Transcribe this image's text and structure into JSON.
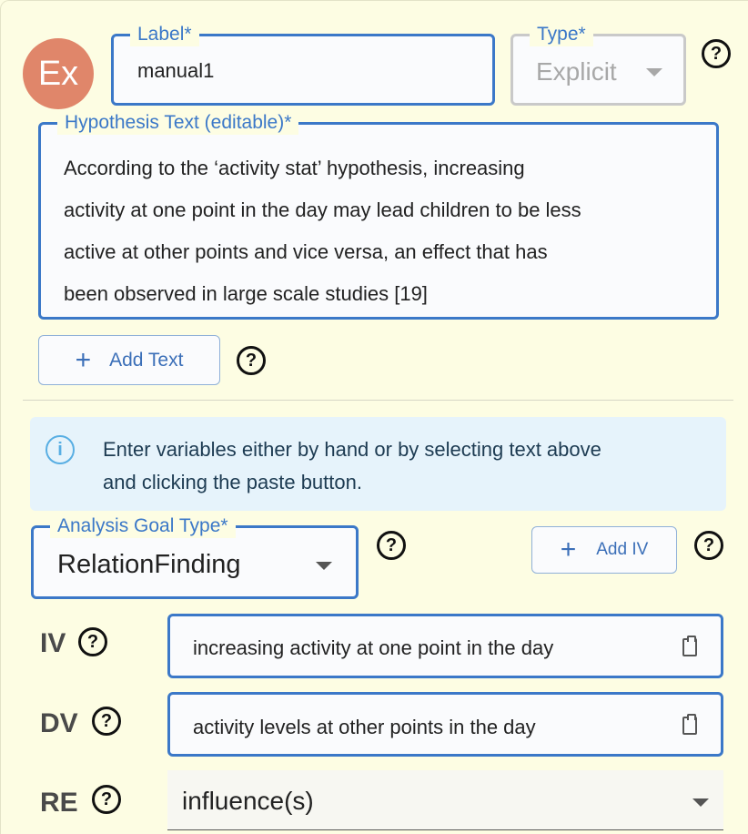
{
  "avatar": {
    "text": "Ex"
  },
  "label_field": {
    "label": "Label",
    "required": "*",
    "value": "manual1"
  },
  "type_field": {
    "label": "Type",
    "required": "*",
    "value": "Explicit"
  },
  "hypothesis": {
    "label": "Hypothesis Text (editable)",
    "required": "*",
    "lines": [
      "According to the ‘activity stat’ hypothesis, increasing",
      "activity at one point in the day may lead children to be less",
      "active at other points and vice versa, an effect that has",
      "been observed in large scale studies [19]"
    ]
  },
  "add_text": {
    "label": "Add Text"
  },
  "info": {
    "line1": "Enter variables either by hand or by selecting text above",
    "line2": "and clicking the paste button."
  },
  "goal": {
    "label": "Analysis Goal Type",
    "required": "*",
    "value": "RelationFinding"
  },
  "add_iv": {
    "label": "Add IV"
  },
  "iv": {
    "label": "IV",
    "value": "increasing activity at one point in the day"
  },
  "dv": {
    "label": "DV",
    "value": "activity levels at other points in the day"
  },
  "re": {
    "label": "RE",
    "value": "influence(s)"
  },
  "help_symbol": "?",
  "info_symbol": "i",
  "plus_symbol": "+",
  "colors": {
    "accent": "#3b78c8",
    "background": "#fdfde3",
    "avatar": "#e0866a",
    "info_bg": "#e6f3fb"
  }
}
